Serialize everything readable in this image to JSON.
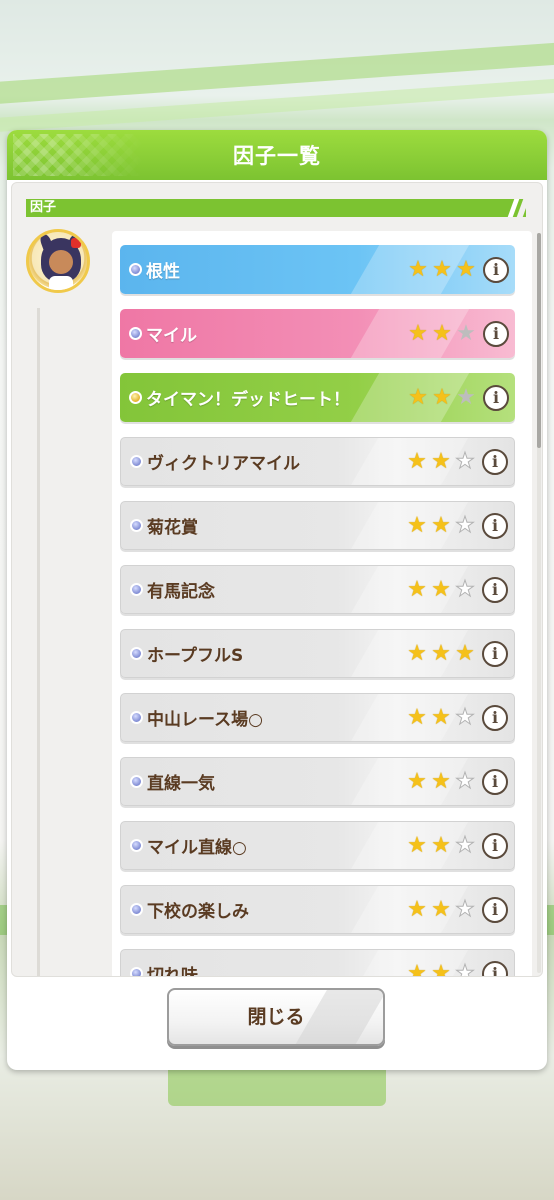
{
  "modal": {
    "title": "因子一覧",
    "section_label": "因子",
    "close_label": "閉じる"
  },
  "factors": [
    {
      "name": "根性",
      "color": "blue",
      "dot": "blue",
      "stars": 3
    },
    {
      "name": "マイル",
      "color": "pink",
      "dot": "blue",
      "stars": 2
    },
    {
      "name": "タイマン！デッドヒート！",
      "color": "green",
      "dot": "gold",
      "stars": 2
    },
    {
      "name": "ヴィクトリアマイル",
      "color": "gray",
      "dot": "blue",
      "stars": 2
    },
    {
      "name": "菊花賞",
      "color": "gray",
      "dot": "blue",
      "stars": 2
    },
    {
      "name": "有馬記念",
      "color": "gray",
      "dot": "blue",
      "stars": 2
    },
    {
      "name": "ホープフルS",
      "color": "gray",
      "dot": "blue",
      "stars": 3
    },
    {
      "name": "中山レース場○",
      "color": "gray",
      "dot": "blue",
      "stars": 2
    },
    {
      "name": "直線一気",
      "color": "gray",
      "dot": "blue",
      "stars": 2
    },
    {
      "name": "マイル直線○",
      "color": "gray",
      "dot": "blue",
      "stars": 2
    },
    {
      "name": "下校の楽しみ",
      "color": "gray",
      "dot": "blue",
      "stars": 2
    },
    {
      "name": "切れ味",
      "color": "gray",
      "dot": "blue",
      "stars": 2
    }
  ],
  "colors": {
    "header": "#7cc331",
    "blue": "#5bb5ee",
    "pink": "#ef77a5",
    "green": "#83c539",
    "star": "#f5c11a"
  },
  "icons": {
    "info": "info-icon",
    "star": "star-icon"
  }
}
